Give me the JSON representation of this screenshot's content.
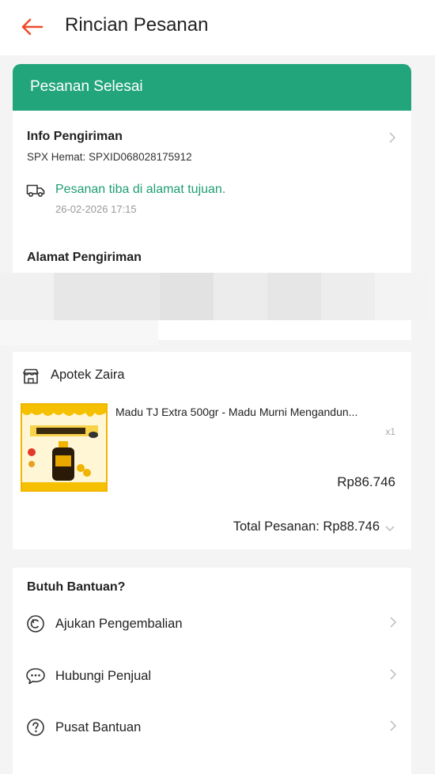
{
  "header": {
    "title": "Rincian Pesanan"
  },
  "status": {
    "text": "Pesanan Selesai"
  },
  "shipping": {
    "section_title": "Info Pengiriman",
    "tracking": "SPX Hemat: SPXID068028175912",
    "event_text": "Pesanan tiba di alamat tujuan.",
    "event_time": "26-02-2026 17:15",
    "address_title": "Alamat Pengiriman"
  },
  "order": {
    "shop_name": "Apotek Zaira",
    "product_title": "Madu TJ Extra 500gr - Madu Murni Mengandun...",
    "quantity": "x1",
    "price": "Rp86.746",
    "total": "Total Pesanan: Rp88.746"
  },
  "help": {
    "title": "Butuh Bantuan?",
    "items": [
      {
        "label": "Ajukan Pengembalian",
        "icon": "return-icon"
      },
      {
        "label": "Hubungi Penjual",
        "icon": "chat-icon"
      },
      {
        "label": "Pusat Bantuan",
        "icon": "help-icon"
      }
    ]
  },
  "colors": {
    "accent_red": "#ee4d2d",
    "status_green": "#23a57c",
    "text_green": "#1f9e74"
  }
}
